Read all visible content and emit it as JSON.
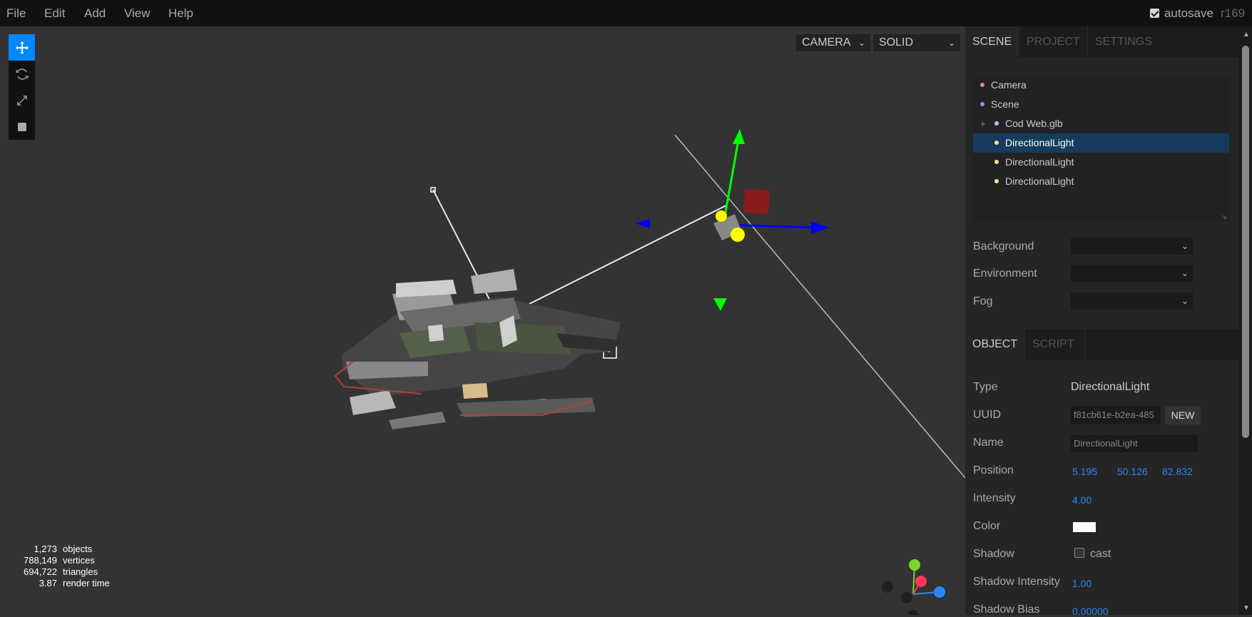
{
  "menubar": {
    "items": [
      "File",
      "Edit",
      "Add",
      "View",
      "Help"
    ],
    "autosave_label": "autosave",
    "autosave_checked": true,
    "revision": "r169"
  },
  "viewport": {
    "tools": [
      "move-icon",
      "rotate-icon",
      "scale-icon",
      "local-toggle-icon"
    ],
    "camera_select": "CAMERA",
    "shading_select": "SOLID",
    "info": [
      {
        "value": "1,273",
        "label": "objects"
      },
      {
        "value": "788,149",
        "label": "vertices"
      },
      {
        "value": "694,722",
        "label": "triangles"
      },
      {
        "value": "3.87",
        "label": "render time"
      }
    ]
  },
  "sidebar": {
    "tabs": [
      "SCENE",
      "PROJECT",
      "SETTINGS"
    ],
    "outliner": [
      {
        "label": "Camera",
        "color": "#e88a7b"
      },
      {
        "label": "Scene",
        "color": "#8c8cff"
      },
      {
        "label": "Cod Web.glb",
        "color": "#c8b4ff"
      },
      {
        "label": "DirectionalLight",
        "color": "#f0e68c"
      },
      {
        "label": "DirectionalLight",
        "color": "#f0e68c"
      },
      {
        "label": "DirectionalLight",
        "color": "#f0e68c"
      }
    ],
    "scene_props": {
      "background_label": "Background",
      "environment_label": "Environment",
      "fog_label": "Fog"
    },
    "object_tabs": [
      "OBJECT",
      "SCRIPT"
    ],
    "object": {
      "type_label": "Type",
      "type_value": "DirectionalLight",
      "uuid_label": "UUID",
      "uuid_value": "f81cb61e-b2ea-485",
      "new_button": "NEW",
      "name_label": "Name",
      "name_value": "DirectionalLight",
      "position_label": "Position",
      "position": [
        "5.195",
        "50.126",
        "82.832"
      ],
      "intensity_label": "Intensity",
      "intensity_value": "4.00",
      "color_label": "Color",
      "color_value": "#ffffff",
      "shadow_label": "Shadow",
      "shadow_cast_label": "cast",
      "shadow_intensity_label": "Shadow Intensity",
      "shadow_intensity_value": "1.00",
      "shadow_bias_label": "Shadow Bias",
      "shadow_bias_value": "0.00000"
    }
  }
}
